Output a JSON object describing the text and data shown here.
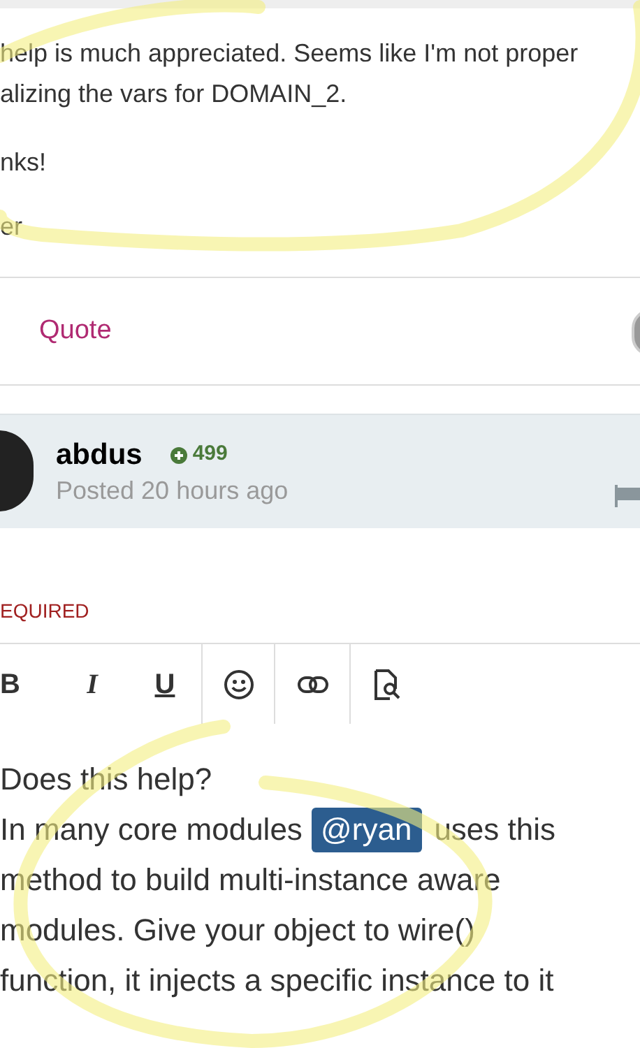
{
  "previous_post": {
    "paragraphs": [
      "help is much appreciated. Seems like I'm not proper",
      "alizing the vars for DOMAIN_2.",
      "nks!",
      "er"
    ],
    "actions": [
      {
        "label": "Quote"
      }
    ]
  },
  "post_header": {
    "author": "abdus",
    "reputation": "499",
    "posted": "Posted 20 hours ago"
  },
  "required_label": "EQUIRED",
  "editor": {
    "toolbar": [
      {
        "kind": "text",
        "label": "B"
      },
      {
        "kind": "text",
        "label": "I"
      },
      {
        "kind": "text",
        "label": "U"
      },
      {
        "kind": "emoji"
      },
      {
        "kind": "link"
      },
      {
        "kind": "preview"
      }
    ],
    "lines": [
      "Does this help?",
      "In many core modules ",
      "uses this",
      "method to build multi-instance aware",
      "modules. Give your object to wire()",
      "function, it injects a specific instance to it"
    ],
    "mention": "@ryan"
  }
}
